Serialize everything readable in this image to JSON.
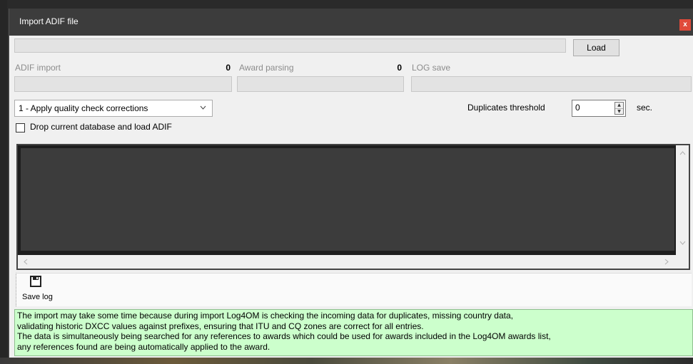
{
  "window": {
    "title": "Import ADIF file",
    "close_label": "x"
  },
  "file_row": {
    "path_value": "",
    "load_label": "Load"
  },
  "progress": {
    "adif_import": {
      "label": "ADIF import",
      "count": "0"
    },
    "award_parsing": {
      "label": "Award parsing",
      "count": "0"
    },
    "log_save": {
      "label": "LOG save"
    }
  },
  "options": {
    "mode_select": "1 - Apply quality check corrections",
    "duplicates_label": "Duplicates threshold",
    "duplicates_value": "0",
    "duplicates_unit": "sec.",
    "drop_db_label": "Drop current database and load ADIF",
    "drop_db_checked": false
  },
  "toolbar": {
    "save_log_label": "Save log"
  },
  "info": {
    "lines": [
      "The import may take some time because during  import Log4OM is checking the incoming data for duplicates, missing country data,",
      "validating historic DXCC values against prefixes, ensuring that ITU and CQ zones are correct for all entries.",
      "The data is simultaneously being searched for any references to awards which could be used for awards included in the Log4OM awards list,",
      "any references found are being automatically applied to the award."
    ]
  },
  "colors": {
    "info_bg": "#ccffcc",
    "titlebar": "#3c3c3c",
    "close_button": "#e04a3a",
    "log_area": "#3c3c3c"
  },
  "icons": {
    "save": "floppy-disk-icon",
    "dropdown": "chevron-down-icon"
  }
}
